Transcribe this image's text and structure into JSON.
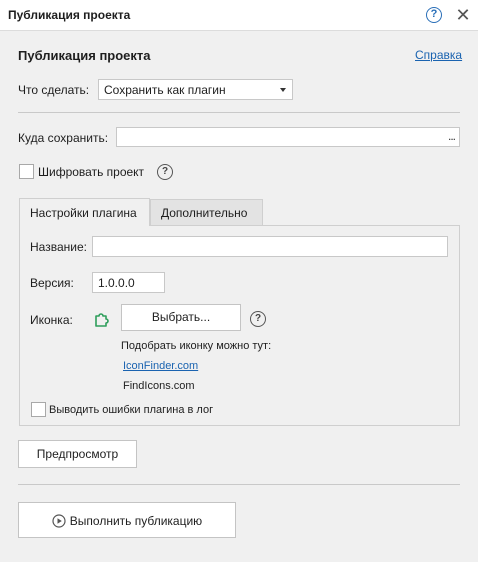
{
  "window": {
    "title": "Публикация проекта"
  },
  "header": {
    "heading": "Публикация проекта",
    "help_link": "Справка"
  },
  "action": {
    "label": "Что сделать:",
    "selected": "Сохранить как плагин"
  },
  "save_path": {
    "label": "Куда сохранить:",
    "value": "",
    "browse": "..."
  },
  "encrypt": {
    "label": "Шифровать проект",
    "checked": false
  },
  "tabs": [
    {
      "label": "Настройки плагина",
      "active": true
    },
    {
      "label": "Дополнительно",
      "active": false
    }
  ],
  "plugin": {
    "name_label": "Название:",
    "name_value": "",
    "version_label": "Версия:",
    "version_value": "1.0.0.0",
    "icon_label": "Иконка:",
    "choose_button": "Выбрать...",
    "hint": "Подобрать иконку можно тут:",
    "link1": "IconFinder.com",
    "link2": "FindIcons.com",
    "log_errors_label": "Выводить ошибки плагина в лог",
    "log_errors_checked": false
  },
  "buttons": {
    "preview": "Предпросмотр",
    "publish": "Выполнить публикацию"
  },
  "colors": {
    "link": "#1a63b0",
    "icon_green": "#2e9e5b",
    "help_blue": "#2a6fb8"
  }
}
